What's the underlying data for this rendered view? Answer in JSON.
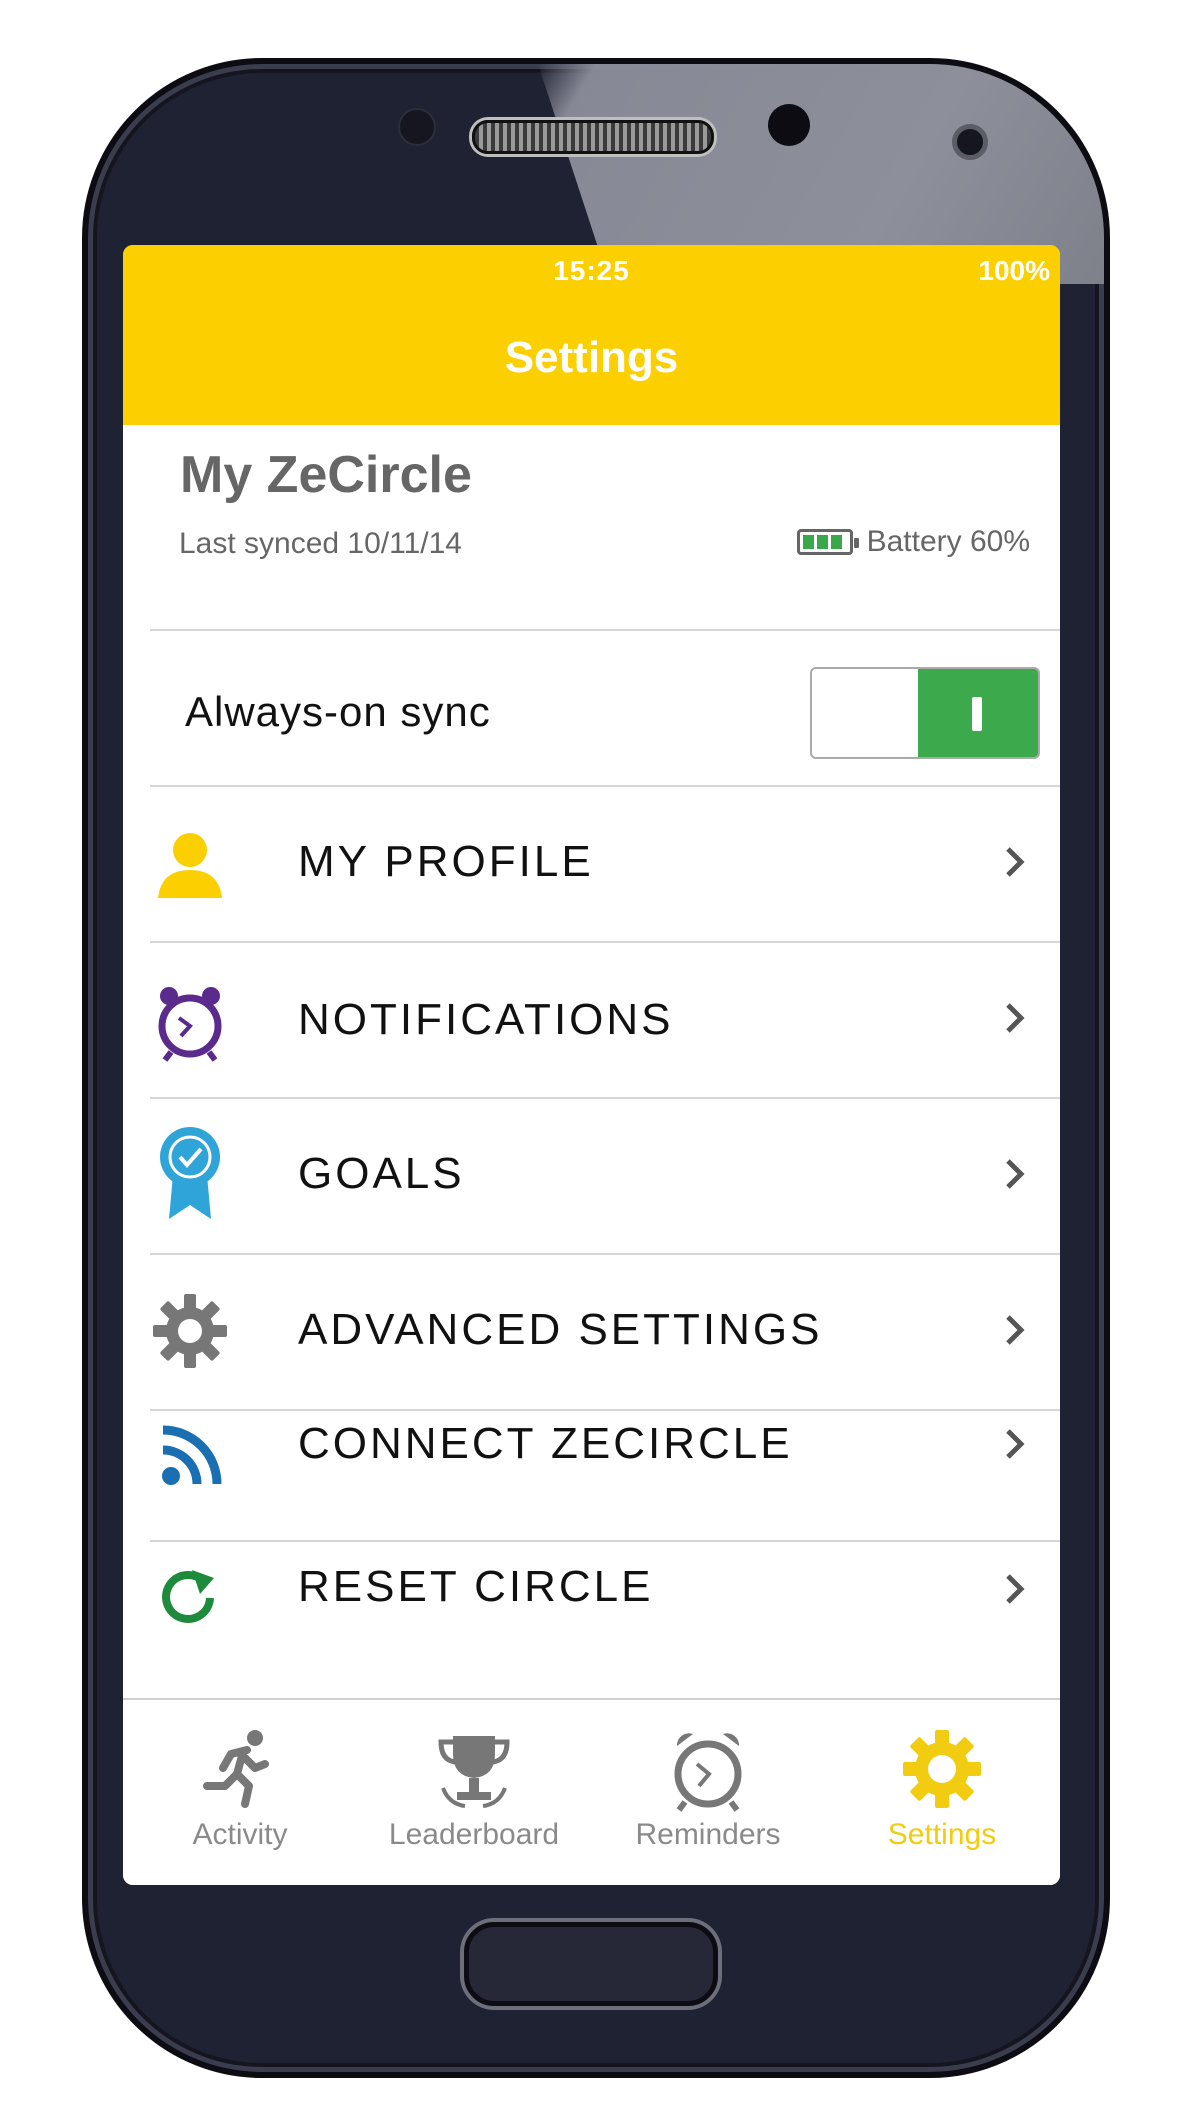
{
  "status_bar": {
    "time": "15:25",
    "battery": "100%"
  },
  "header": {
    "title": "Settings"
  },
  "device": {
    "name": "My ZeCircle",
    "last_synced": "Last synced 10/11/14",
    "battery_text": "Battery 60%",
    "battery_level": 0.6
  },
  "always_on_sync": {
    "label": "Always-on sync",
    "enabled": true
  },
  "menu": {
    "items": [
      {
        "label": "MY PROFILE",
        "icon": "user-icon"
      },
      {
        "label": "NOTIFICATIONS",
        "icon": "alarm-clock-icon"
      },
      {
        "label": "GOALS",
        "icon": "award-badge-icon"
      },
      {
        "label": "ADVANCED SETTINGS",
        "icon": "gear-icon"
      },
      {
        "label": "CONNECT ZECIRCLE",
        "icon": "rss-icon"
      },
      {
        "label": "RESET CIRCLE",
        "icon": "refresh-icon"
      }
    ]
  },
  "tabs": [
    {
      "label": "Activity",
      "icon": "runner-icon",
      "active": false
    },
    {
      "label": "Leaderboard",
      "icon": "trophy-icon",
      "active": false
    },
    {
      "label": "Reminders",
      "icon": "alarm-clock-icon",
      "active": false
    },
    {
      "label": "Settings",
      "icon": "gear-icon",
      "active": true
    }
  ],
  "colors": {
    "accent": "#fcd000",
    "toggle_on": "#3caa4c",
    "tab_active": "#f2cc10",
    "tab_inactive": "#8a8a8a"
  }
}
